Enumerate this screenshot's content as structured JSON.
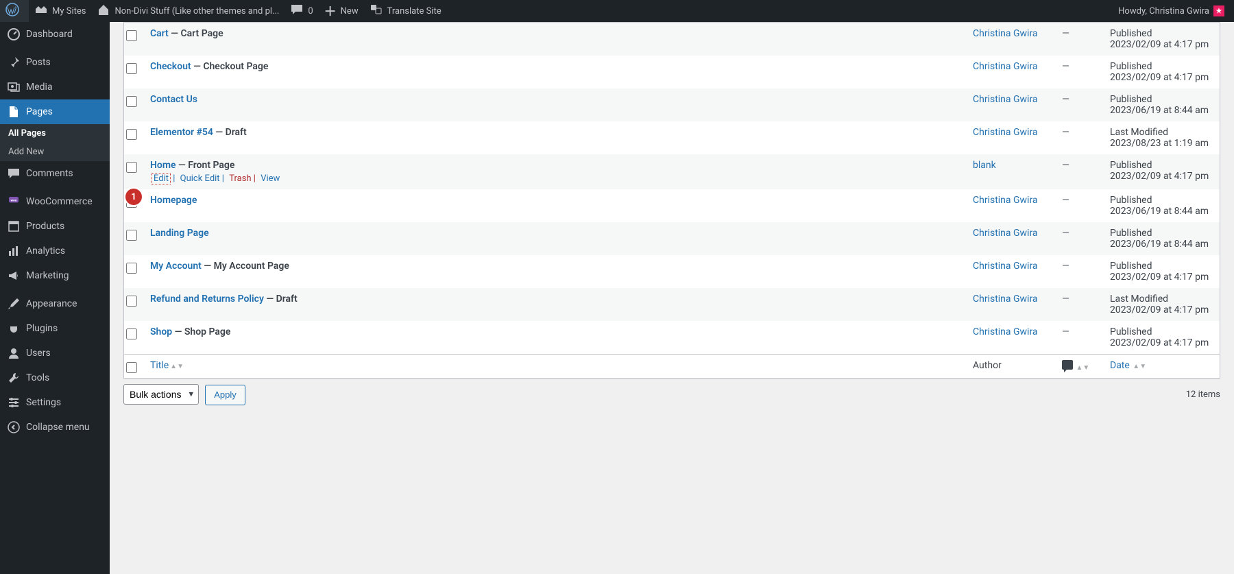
{
  "adminbar": {
    "mysites": "My Sites",
    "sitename": "Non-Divi Stuff (Like other themes and pl...",
    "comments": "0",
    "new": "New",
    "translate": "Translate Site",
    "howdy": "Howdy, Christina Gwira"
  },
  "menu": {
    "dashboard": "Dashboard",
    "posts": "Posts",
    "media": "Media",
    "pages": "Pages",
    "all_pages": "All Pages",
    "add_new": "Add New",
    "comments": "Comments",
    "woocommerce": "WooCommerce",
    "products": "Products",
    "analytics": "Analytics",
    "marketing": "Marketing",
    "appearance": "Appearance",
    "plugins": "Plugins",
    "users": "Users",
    "tools": "Tools",
    "settings": "Settings",
    "collapse": "Collapse menu"
  },
  "columns": {
    "title": "Title",
    "author": "Author",
    "date": "Date"
  },
  "rows": [
    {
      "title": "Cart",
      "state": "Cart Page",
      "author": "Christina Gwira",
      "status": "Published",
      "date": "2023/02/09 at 4:17 pm"
    },
    {
      "title": "Checkout",
      "state": "Checkout Page",
      "author": "Christina Gwira",
      "status": "Published",
      "date": "2023/02/09 at 4:17 pm"
    },
    {
      "title": "Contact Us",
      "state": "",
      "author": "Christina Gwira",
      "status": "Published",
      "date": "2023/06/19 at 8:44 am"
    },
    {
      "title": "Elementor #54",
      "state": "Draft",
      "author": "Christina Gwira",
      "status": "Last Modified",
      "date": "2023/08/23 at 1:19 am"
    },
    {
      "title": "Home",
      "state": "Front Page",
      "author": "blank",
      "status": "Published",
      "date": "2023/02/09 at 4:17 pm",
      "actions": true
    },
    {
      "title": "Homepage",
      "state": "",
      "author": "Christina Gwira",
      "status": "Published",
      "date": "2023/06/19 at 8:44 am"
    },
    {
      "title": "Landing Page",
      "state": "",
      "author": "Christina Gwira",
      "status": "Published",
      "date": "2023/06/19 at 8:44 am"
    },
    {
      "title": "My Account",
      "state": "My Account Page",
      "author": "Christina Gwira",
      "status": "Published",
      "date": "2023/02/09 at 4:17 pm"
    },
    {
      "title": "Refund and Returns Policy",
      "state": "Draft",
      "author": "Christina Gwira",
      "status": "Last Modified",
      "date": "2023/02/09 at 4:17 pm"
    },
    {
      "title": "Shop",
      "state": "Shop Page",
      "author": "Christina Gwira",
      "status": "Published",
      "date": "2023/02/09 at 4:17 pm"
    }
  ],
  "actions": {
    "edit": "Edit",
    "quick": "Quick Edit",
    "trash": "Trash",
    "view": "View"
  },
  "callout": "1",
  "bulk": {
    "label": "Bulk actions",
    "apply": "Apply"
  },
  "count": "12 items"
}
